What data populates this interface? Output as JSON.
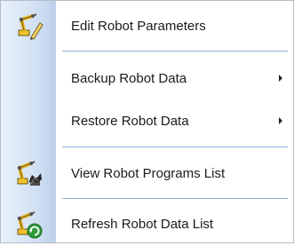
{
  "menu": {
    "items": [
      {
        "label": "Edit Robot Parameters",
        "icon": "robot-edit-icon"
      },
      {
        "label": "Backup Robot Data",
        "icon": "",
        "submenu": true
      },
      {
        "label": "Restore Robot Data",
        "icon": "",
        "submenu": true
      },
      {
        "label": "View Robot Programs List",
        "icon": "robot-programs-icon"
      },
      {
        "label": "Refresh Robot Data List",
        "icon": "robot-refresh-icon"
      }
    ]
  },
  "colors": {
    "gutter": "#cfdff3",
    "separator": "#8fb0da",
    "robot_yellow": "#f4c20d"
  }
}
